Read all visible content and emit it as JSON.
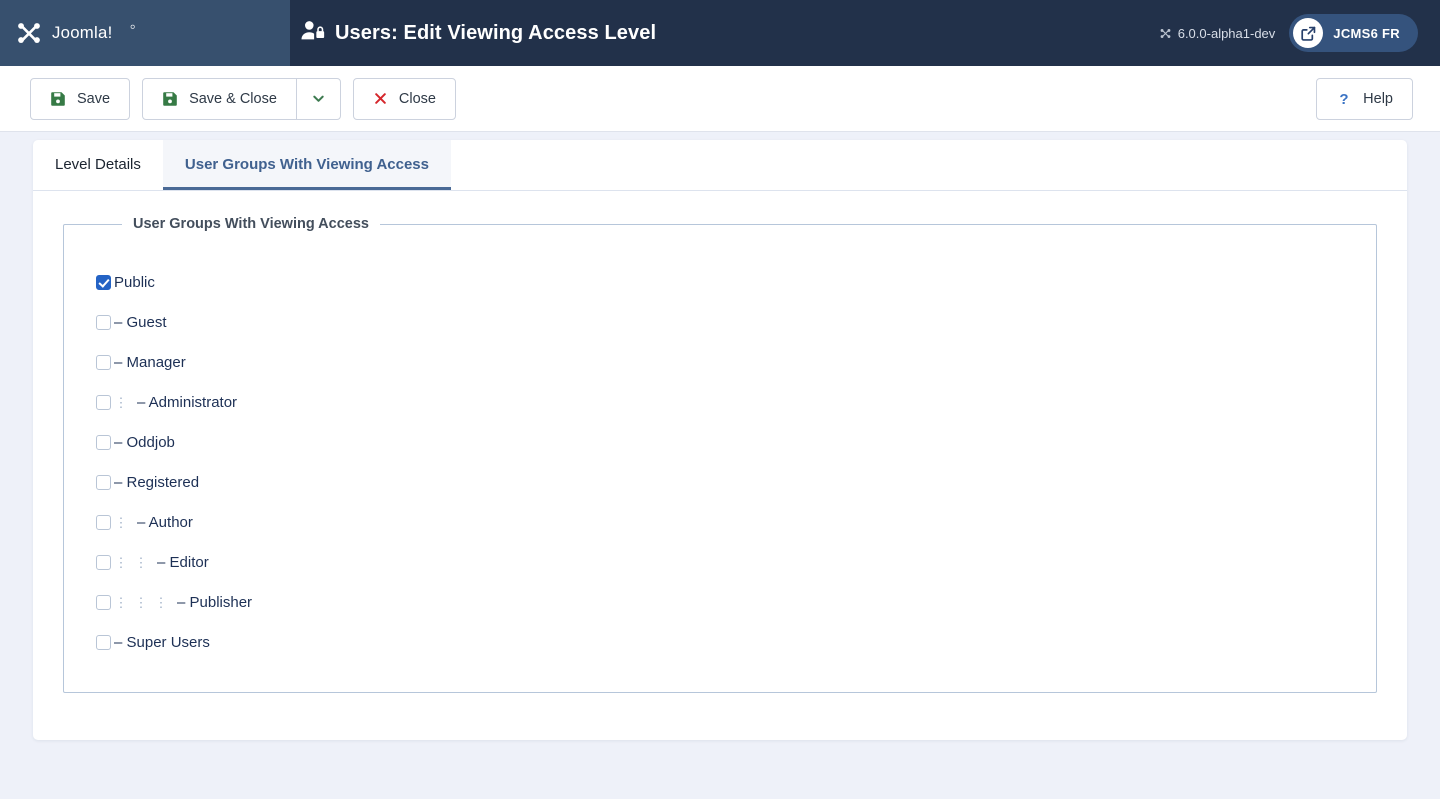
{
  "header": {
    "brand_name": "Joomla!",
    "brand_logo_icon": "joomla-logo-icon",
    "page_icon": "user-lock-icon",
    "title": "Users: Edit Viewing Access Level",
    "version_icon": "joomla-mark-icon",
    "version": "6.0.0-alpha1-dev",
    "user_pill_icon": "external-link-icon",
    "user_name": "JCMS6 FR",
    "colors": {
      "brand_bg": "#37506e",
      "header_bg": "#22314a",
      "pill_bg": "#35537d"
    }
  },
  "toolbar": {
    "save_label": "Save",
    "save_icon": "floppy-save-icon",
    "save_close_label": "Save & Close",
    "save_close_icon": "floppy-save-icon",
    "dropdown_icon": "chevron-down-icon",
    "close_label": "Close",
    "close_icon": "x-icon",
    "help_label": "Help",
    "help_icon": "question-mark-icon",
    "colors": {
      "save_icon": "#367a45",
      "close_icon": "#d5262b",
      "help_icon": "#3a73c4"
    }
  },
  "tabs": [
    {
      "label": "Level Details",
      "active": false
    },
    {
      "label": "User Groups With Viewing Access",
      "active": true
    }
  ],
  "fieldset": {
    "legend": "User Groups With Viewing Access",
    "groups": [
      {
        "label": "Public",
        "level": 0,
        "checked": true,
        "dash": ""
      },
      {
        "label": "Guest",
        "level": 0,
        "checked": false,
        "dash": "–"
      },
      {
        "label": "Manager",
        "level": 0,
        "checked": false,
        "dash": "–"
      },
      {
        "label": "Administrator",
        "level": 1,
        "checked": false,
        "dash": "–"
      },
      {
        "label": "Oddjob",
        "level": 0,
        "checked": false,
        "dash": "–"
      },
      {
        "label": "Registered",
        "level": 0,
        "checked": false,
        "dash": "–"
      },
      {
        "label": "Author",
        "level": 1,
        "checked": false,
        "dash": "–"
      },
      {
        "label": "Editor",
        "level": 2,
        "checked": false,
        "dash": "–"
      },
      {
        "label": "Publisher",
        "level": 3,
        "checked": false,
        "dash": "–"
      },
      {
        "label": "Super Users",
        "level": 0,
        "checked": false,
        "dash": "–"
      }
    ],
    "indent_marker_glyph": "⋮"
  }
}
